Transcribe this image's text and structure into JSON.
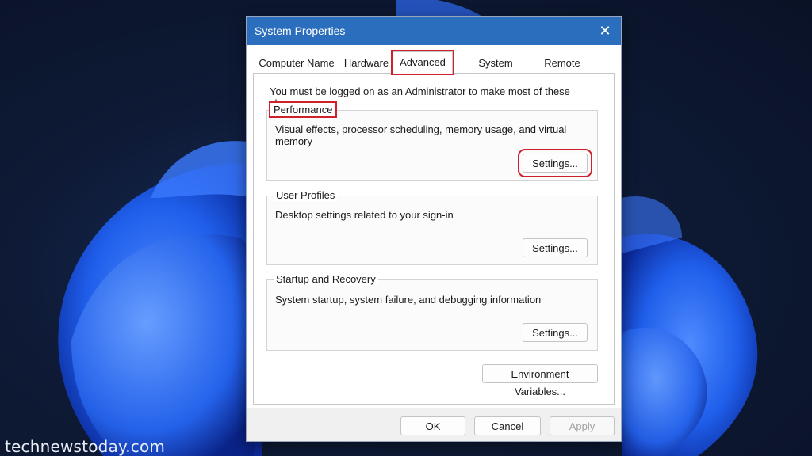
{
  "watermark": "technewstoday.com",
  "dialog": {
    "title": "System Properties",
    "close_glyph": "✕",
    "tabs": [
      {
        "label": "Computer Name",
        "active": false
      },
      {
        "label": "Hardware",
        "active": false
      },
      {
        "label": "Advanced",
        "active": true
      },
      {
        "label": "System Protection",
        "active": false
      },
      {
        "label": "Remote",
        "active": false
      }
    ],
    "admin_note": "You must be logged on as an Administrator to make most of these changes.",
    "groups": {
      "performance": {
        "label": "Performance",
        "description": "Visual effects, processor scheduling, memory usage, and virtual memory",
        "button": "Settings..."
      },
      "user_profiles": {
        "label": "User Profiles",
        "description": "Desktop settings related to your sign-in",
        "button": "Settings..."
      },
      "startup_recovery": {
        "label": "Startup and Recovery",
        "description": "System startup, system failure, and debugging information",
        "button": "Settings..."
      }
    },
    "environment_button": "Environment Variables...",
    "footer": {
      "ok": "OK",
      "cancel": "Cancel",
      "apply": "Apply",
      "apply_enabled": false
    }
  },
  "colors": {
    "titlebar": "#2a6ebd",
    "highlight": "#d0202a",
    "wallpaper_accent": "#1f5eea"
  },
  "icons": {
    "close": "close-icon"
  }
}
